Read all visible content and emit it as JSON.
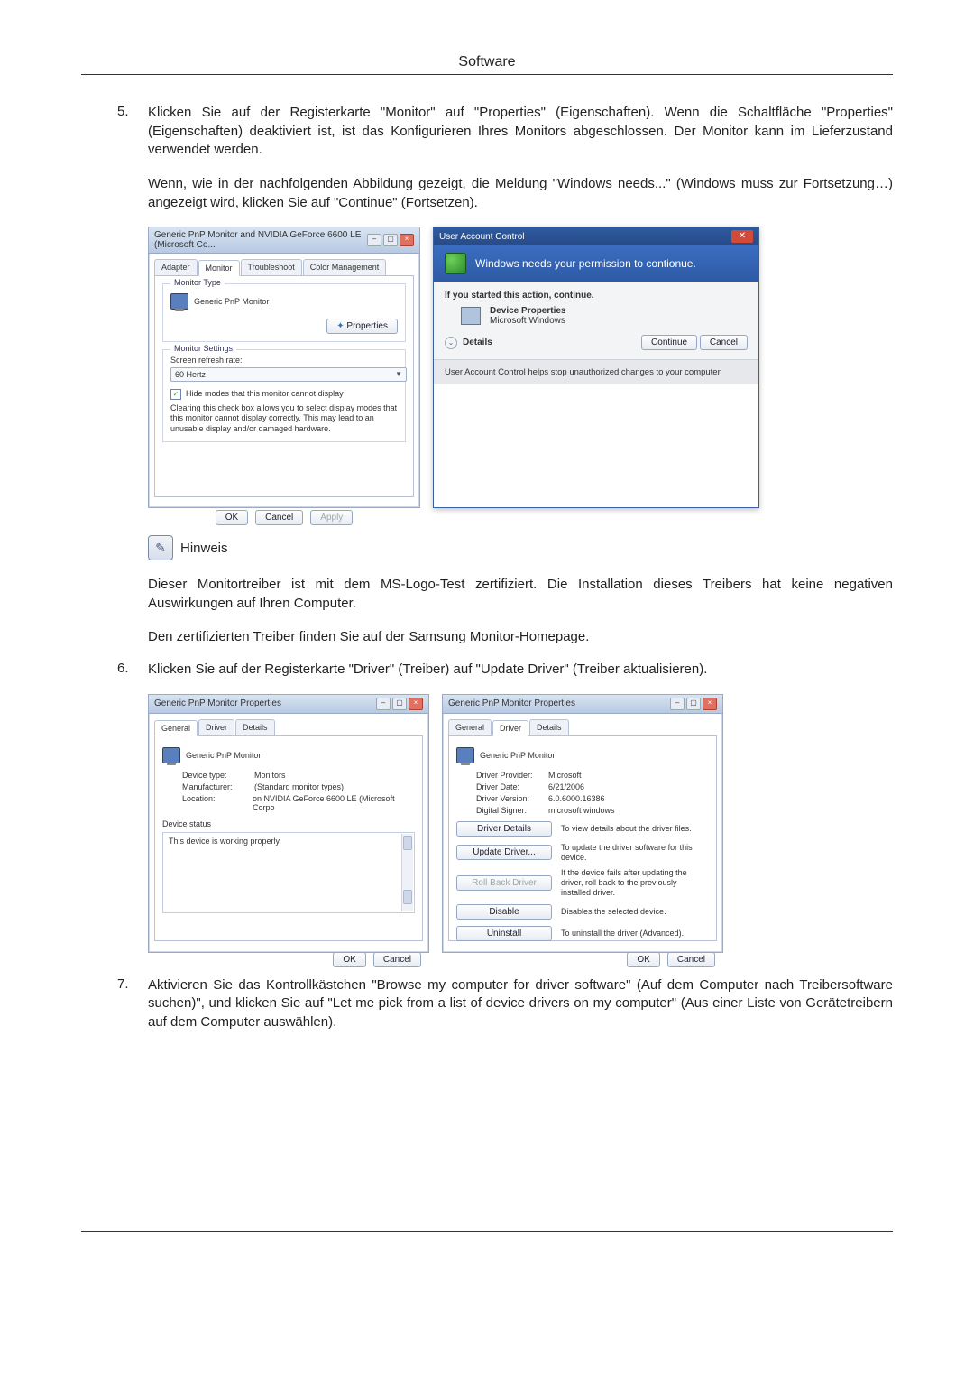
{
  "header": {
    "title": "Software"
  },
  "steps": {
    "s5": {
      "num": "5.",
      "text": "Klicken Sie auf der Registerkarte \"Monitor\" auf \"Properties\" (Eigenschaften). Wenn die Schaltfläche \"Properties\" (Eigenschaften) deaktiviert ist, ist das Konfigurieren Ihres Monitors abgeschlossen. Der Monitor kann im Lieferzustand verwendet werden.",
      "para2": "Wenn, wie in der nachfolgenden Abbildung gezeigt, die Meldung \"Windows needs...\" (Windows muss zur Fortsetzung…) angezeigt wird, klicken Sie auf \"Continue\" (Fortsetzen)."
    },
    "s6": {
      "num": "6.",
      "text": "Klicken Sie auf der Registerkarte \"Driver\" (Treiber) auf \"Update Driver\" (Treiber aktualisieren)."
    },
    "s7": {
      "num": "7.",
      "text": "Aktivieren Sie das Kontrollkästchen \"Browse my computer for driver software\" (Auf dem Computer nach Treibersoftware suchen)\", und klicken Sie auf \"Let me pick from a list of device drivers on my computer\" (Aus einer Liste von Gerätetreibern auf dem Computer auswählen)."
    }
  },
  "hinweis": {
    "label": "Hinweis",
    "p1": "Dieser Monitortreiber ist mit dem MS-Logo-Test zertifiziert. Die Installation dieses Treibers hat keine negativen Auswirkungen auf Ihren Computer.",
    "p2": "Den zertifizierten Treiber finden Sie auf der Samsung Monitor-Homepage."
  },
  "dlg_monitor": {
    "title": "Generic PnP Monitor and NVIDIA GeForce 6600 LE (Microsoft Co...",
    "tabs": {
      "adapter": "Adapter",
      "monitor": "Monitor",
      "troubleshoot": "Troubleshoot",
      "color": "Color Management"
    },
    "type_group": "Monitor Type",
    "monitor_name": "Generic PnP Monitor",
    "properties_btn": "Properties",
    "settings_group": "Monitor Settings",
    "refresh_label": "Screen refresh rate:",
    "refresh_value": "60 Hertz",
    "hide_check": "Hide modes that this monitor cannot display",
    "hide_desc": "Clearing this check box allows you to select display modes that this monitor cannot display correctly. This may lead to an unusable display and/or damaged hardware.",
    "ok": "OK",
    "cancel": "Cancel",
    "apply": "Apply"
  },
  "uac": {
    "titlebar": "User Account Control",
    "headline": "Windows needs your permission to contionue.",
    "sub": "If you started this action, continue.",
    "prog_name": "Device Properties",
    "prog_pub": "Microsoft Windows",
    "details": "Details",
    "continue": "Continue",
    "cancel": "Cancel",
    "footer": "User Account Control helps stop unauthorized changes to your computer."
  },
  "dlg_general": {
    "title": "Generic PnP Monitor Properties",
    "tabs": {
      "general": "General",
      "driver": "Driver",
      "details": "Details"
    },
    "monitor_name": "Generic PnP Monitor",
    "fields": {
      "type_k": "Device type:",
      "type_v": "Monitors",
      "manu_k": "Manufacturer:",
      "manu_v": "(Standard monitor types)",
      "loc_k": "Location:",
      "loc_v": "on NVIDIA GeForce 6600 LE (Microsoft Corpo"
    },
    "status_group": "Device status",
    "status_text": "This device is working properly.",
    "ok": "OK",
    "cancel": "Cancel"
  },
  "dlg_driver": {
    "title": "Generic PnP Monitor Properties",
    "tabs": {
      "general": "General",
      "driver": "Driver",
      "details": "Details"
    },
    "monitor_name": "Generic PnP Monitor",
    "fields": {
      "prov_k": "Driver Provider:",
      "prov_v": "Microsoft",
      "date_k": "Driver Date:",
      "date_v": "6/21/2006",
      "ver_k": "Driver Version:",
      "ver_v": "6.0.6000.16386",
      "sig_k": "Digital Signer:",
      "sig_v": "microsoft windows"
    },
    "actions": {
      "details_btn": "Driver Details",
      "details_desc": "To view details about the driver files.",
      "update_btn": "Update Driver...",
      "update_desc": "To update the driver software for this device.",
      "rollback_btn": "Roll Back Driver",
      "rollback_desc": "If the device fails after updating the driver, roll back to the previously installed driver.",
      "disable_btn": "Disable",
      "disable_desc": "Disables the selected device.",
      "uninstall_btn": "Uninstall",
      "uninstall_desc": "To uninstall the driver (Advanced)."
    },
    "ok": "OK",
    "cancel": "Cancel"
  }
}
